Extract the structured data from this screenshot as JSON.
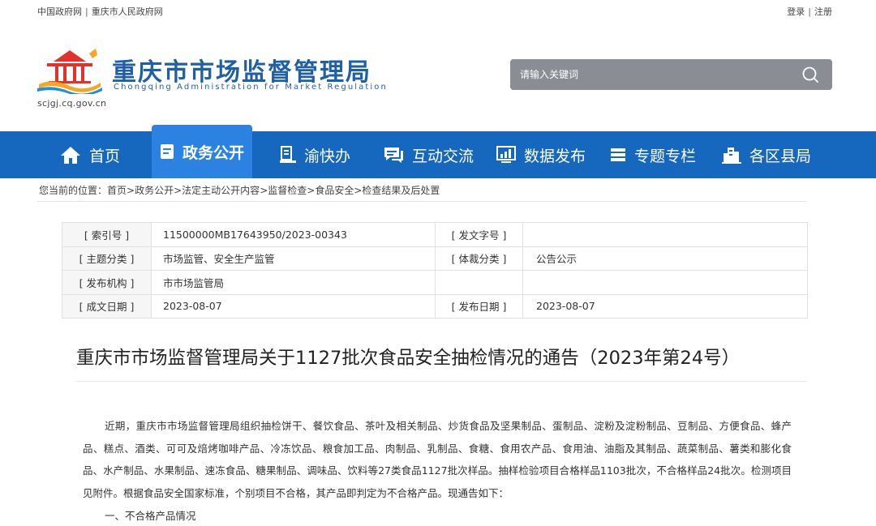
{
  "topbar": {
    "link1": "中国政府网",
    "link2": "重庆市人民政府网",
    "login": "登录",
    "register": "注册",
    "divider": "|"
  },
  "header": {
    "title": "重庆市市场监督管理局",
    "subtitle": "Chongqing  Administration for Market Regulation",
    "domain": "scjgj.cq.gov.cn",
    "logo_icon": "city-emblem-icon"
  },
  "search": {
    "placeholder": "请输入关键词",
    "icon": "search-icon"
  },
  "nav": {
    "items": [
      {
        "label": "首页",
        "icon": "home-icon"
      },
      {
        "label": "政务公开",
        "icon": "document-icon"
      },
      {
        "label": "渝快办",
        "icon": "badge-icon"
      },
      {
        "label": "互动交流",
        "icon": "chat-icon"
      },
      {
        "label": "数据发布",
        "icon": "chart-icon"
      },
      {
        "label": "专题专栏",
        "icon": "list-icon"
      },
      {
        "label": "各区县局",
        "icon": "building-icon"
      }
    ],
    "active_index": 1
  },
  "breadcrumb": {
    "prefix": "您当前的位置：",
    "items": [
      "首页",
      "政务公开",
      "法定主动公开内容",
      "监督检查",
      "食品安全",
      "检查结果及后处置"
    ],
    "sep": ">"
  },
  "info": {
    "index_no_label": "[ 索引号 ]",
    "index_no": "11500000MB17643950/2023-00343",
    "doc_no_label": "[ 发文字号 ]",
    "doc_no": "",
    "topic_label": "[ 主题分类 ]",
    "topic": "市场监管、安全生产监管",
    "genre_label": "[ 体裁分类 ]",
    "genre": "公告公示",
    "publisher_label": "[ 发布机构 ]",
    "publisher": "市市场监管局",
    "written_label": "[ 成文日期 ]",
    "written_date": "2023-08-07",
    "published_label": "[ 发布日期 ]",
    "published_date": "2023-08-07"
  },
  "article": {
    "title": "重庆市市场监督管理局关于1127批次食品安全抽检情况的通告（2023年第24号）",
    "body": "近期，重庆市市场监督管理局组织抽检饼干、餐饮食品、茶叶及相关制品、炒货食品及坚果制品、蛋制品、淀粉及淀粉制品、豆制品、方便食品、蜂产品、糕点、酒类、可可及焙烤咖啡产品、冷冻饮品、粮食加工品、肉制品、乳制品、食糖、食用农产品、食用油、油脂及其制品、蔬菜制品、薯类和膨化食品、水产制品、水果制品、速冻食品、糖果制品、调味品、饮料等27类食品1127批次样品。抽样检验项目合格样品1103批次，不合格样品24批次。检测项目见附件。根据食品安全国家标准，个别项目不合格，其产品即判定为不合格产品。现通告如下：",
    "section1": "一、不合格产品情况"
  },
  "colors": {
    "nav_bg": "#1667be",
    "nav_active": "#2b82e0",
    "brand_text": "#1f5fa8",
    "search_bg": "#8a8d93"
  }
}
